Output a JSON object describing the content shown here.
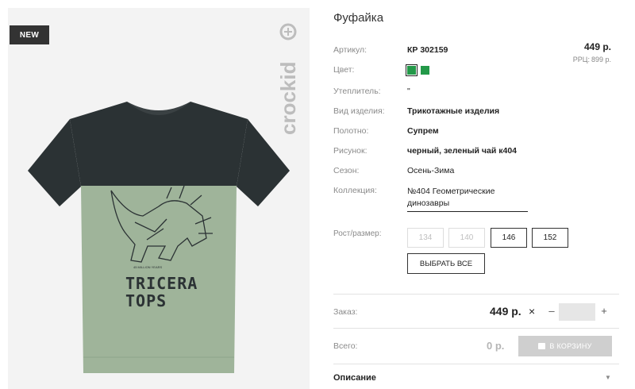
{
  "badge": "NEW",
  "brand": "crockid",
  "print_text": {
    "small": "45 MILLION YEARS",
    "line1": "TRICERA",
    "line2": "TOPS"
  },
  "product": {
    "title": "Фуфайка",
    "price": "449 р.",
    "rrp_label": "РРЦ:",
    "rrp_value": "899 р."
  },
  "attributes": [
    {
      "label": "Артикул:",
      "value": "КР 302159",
      "bold": true
    },
    {
      "label": "Цвет:",
      "value": "",
      "swatches": [
        "#239949",
        "#239949"
      ]
    },
    {
      "label": "Утеплитель:",
      "value": "\"",
      "bold": false
    },
    {
      "label": "Вид изделия:",
      "value": "Трикотажные изделия",
      "bold": true
    },
    {
      "label": "Полотно:",
      "value": "Супрем",
      "bold": true
    },
    {
      "label": "Рисунок:",
      "value": "черный, зеленый чай к404",
      "bold": true
    },
    {
      "label": "Сезон:",
      "value": "Осень-Зима",
      "bold": false
    },
    {
      "label": "Коллекция:",
      "value": "№404 Геометрические динозавры",
      "bold": false
    }
  ],
  "sizes": {
    "label": "Рост/размер:",
    "options": [
      {
        "label": "134",
        "available": false
      },
      {
        "label": "140",
        "available": false
      },
      {
        "label": "146",
        "available": true
      },
      {
        "label": "152",
        "available": true
      }
    ],
    "select_all": "ВЫБРАТЬ ВСЕ"
  },
  "order": {
    "label": "Заказ:",
    "price": "449 р.",
    "times": "×",
    "minus": "–",
    "plus": "+",
    "qty": ""
  },
  "total": {
    "label": "Всего:",
    "value": "0 р.",
    "cart_button": "В КОРЗИНУ"
  },
  "description": {
    "label": "Описание",
    "caret": "▼"
  },
  "colors": {
    "swatch": "#239949",
    "shirt_top": "#2b3234",
    "shirt_bottom": "#9fb49a",
    "cart_disabled": "#cfcfcf"
  }
}
